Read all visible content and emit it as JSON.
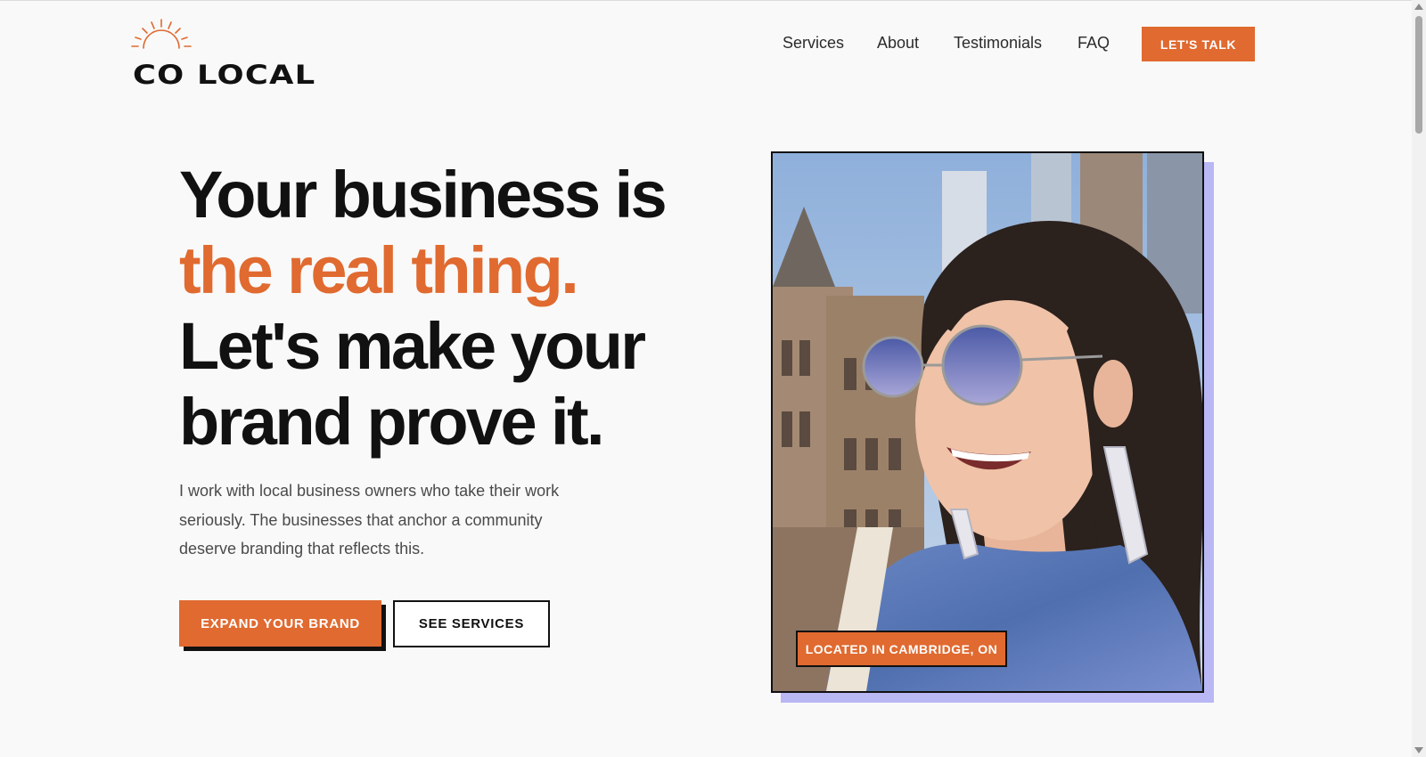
{
  "brand": {
    "name": "CO LOCAL",
    "logo_icon": "sun-icon",
    "accent": "#e06a30",
    "shadow_accent": "#b9b7f4"
  },
  "nav": {
    "items": [
      {
        "label": "Services"
      },
      {
        "label": "About"
      },
      {
        "label": "Testimonials"
      },
      {
        "label": "FAQ"
      }
    ],
    "cta": "LET'S TALK"
  },
  "hero": {
    "headline_1": "Your business is",
    "headline_2": "the real thing.",
    "headline_3": "Let's make your",
    "headline_4": "brand prove it.",
    "lede": "I work with local business owners who take their work seriously. The businesses that anchor a community deserve branding that reflects this.",
    "primary_cta": "EXPAND YOUR BRAND",
    "secondary_cta": "SEE SERVICES",
    "photo_alt_icon": "portrait-photo",
    "location_badge": "LOCATED IN CAMBRIDGE, ON"
  }
}
